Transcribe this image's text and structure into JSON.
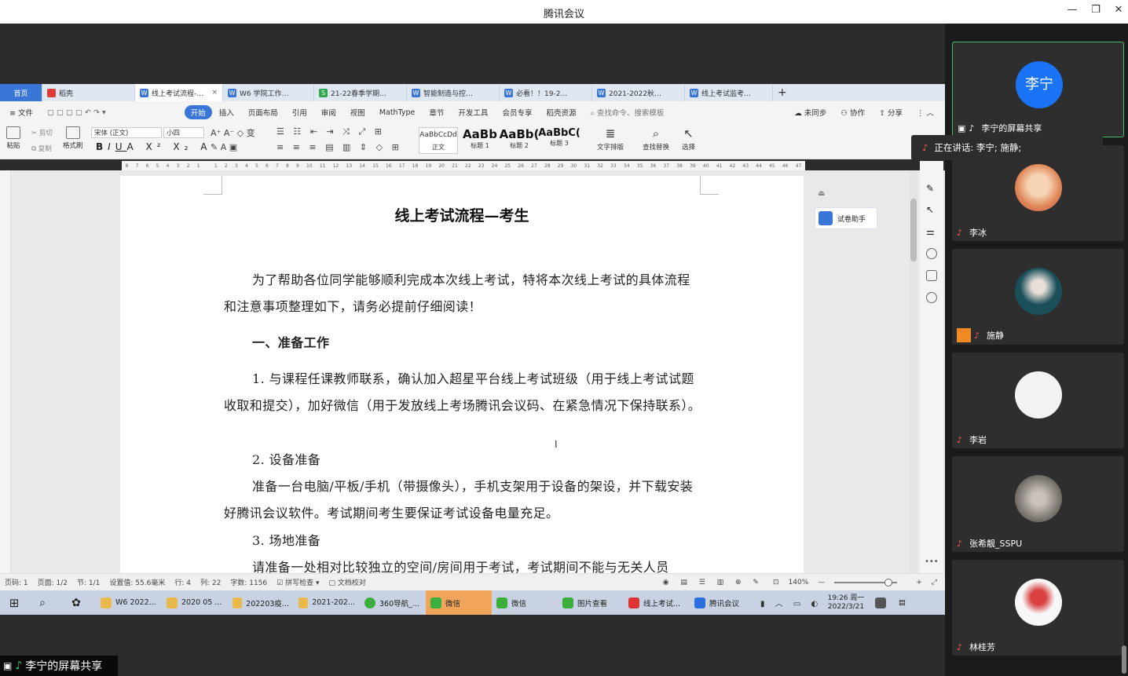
{
  "window": {
    "title": "腾讯会议"
  },
  "wps": {
    "tabs": [
      {
        "label": "首页",
        "kind": "home"
      },
      {
        "label": "稻壳",
        "color": "#e03b3b"
      },
      {
        "label": "线上考试流程-…",
        "color": "#3a76d8",
        "active": true
      },
      {
        "label": "W6 学院工作…",
        "color": "#3a76d8"
      },
      {
        "label": "21-22春季学期…",
        "color": "#2fa94e"
      },
      {
        "label": "智能制造与控…",
        "color": "#3a76d8"
      },
      {
        "label": "必看！！19-2…",
        "color": "#3a76d8"
      },
      {
        "label": "2021-2022秋…",
        "color": "#3a76d8"
      },
      {
        "label": "线上考试监考…",
        "color": "#3a76d8"
      }
    ],
    "menu": [
      "文件",
      "开始",
      "插入",
      "页面布局",
      "引用",
      "审阅",
      "视图",
      "MathType",
      "章节",
      "开发工具",
      "会员专享",
      "稻壳资源",
      "查找命令、搜索模板"
    ],
    "menu_right": [
      "未同步",
      "协作",
      "分享"
    ],
    "ribbon": {
      "paste": "粘贴",
      "cut": "剪切",
      "copy": "复制",
      "format_painter": "格式刷",
      "font_name": "宋体 (正文)",
      "font_size": "小四",
      "styles": [
        {
          "preview": "AaBbCcDd",
          "label": "正文"
        },
        {
          "preview": "AaBb",
          "label": "标题 1"
        },
        {
          "preview": "AaBb(",
          "label": "标题 2"
        },
        {
          "preview": "AaBbC(",
          "label": "标题 3"
        }
      ],
      "text_layout": "文字排版",
      "find_replace": "查找替换",
      "select": "选择"
    },
    "ruler_ticks": [
      "8",
      "7",
      "6",
      "5",
      "4",
      "3",
      "2",
      "1",
      "",
      "1",
      "2",
      "3",
      "4",
      "5",
      "6",
      "7",
      "8",
      "9",
      "10",
      "11",
      "12",
      "13",
      "14",
      "15",
      "16",
      "17",
      "18",
      "19",
      "20",
      "21",
      "22",
      "23",
      "24",
      "25",
      "26",
      "27",
      "28",
      "29",
      "30",
      "31",
      "32",
      "33",
      "34",
      "35",
      "36",
      "37",
      "38",
      "39",
      "40",
      "41",
      "42",
      "43",
      "44",
      "45",
      "46",
      "47"
    ],
    "document": {
      "title": "线上考试流程—考生",
      "intro": "为了帮助各位同学能够顺利完成本次线上考试，特将本次线上考试的具体流程和注意事项整理如下，请务必提前仔细阅读！",
      "section1": "一、准备工作",
      "item1": "1.  与课程任课教师联系，确认加入超星平台线上考试班级（用于线上考试试题收取和提交），加好微信（用于发放线上考场腾讯会议码、在紧急情况下保持联系）。",
      "item2_head": "2.  设备准备",
      "item2_body": "准备一台电脑/平板/手机（带摄像头），手机支架用于设备的架设，并下载安装好腾讯会议软件。考试期间考生要保证考试设备电量充足。",
      "item3_head": "3.  场地准备",
      "item3_body": "请准备一处相对比较独立的空间/房间用于考试，考试期间不能与无关人员"
    },
    "assistant": "试卷助手",
    "status": {
      "page_num": "页码: 1",
      "pages": "页面: 1/2",
      "section": "节: 1/1",
      "setting": "设置值: 55.6毫米",
      "row": "行: 4",
      "col": "列: 22",
      "words": "字数: 1156",
      "spell": "拼写检查",
      "proof": "文档校对",
      "zoom": "140%"
    }
  },
  "taskbar": {
    "items": [
      {
        "label": "W6 2022...",
        "color": "#e8b84a"
      },
      {
        "label": "2020 05 ...",
        "color": "#e8b84a"
      },
      {
        "label": "202203疫...",
        "color": "#e8b84a"
      },
      {
        "label": "2021-202...",
        "color": "#e8b84a"
      },
      {
        "label": "360导航_...",
        "color": "#3cae3c"
      },
      {
        "label": "微信",
        "color": "#3cae3c",
        "highlight": true
      },
      {
        "label": "微信",
        "color": "#3cae3c"
      },
      {
        "label": "图片查看",
        "color": "#3cae3c"
      },
      {
        "label": "线上考试...",
        "color": "#d33"
      },
      {
        "label": "腾讯会议",
        "color": "#2a6fdb"
      }
    ],
    "time": "19:26 周一",
    "date": "2022/3/21"
  },
  "share_label": "李宁的屏幕共享",
  "speaking": "正在讲话: 李宁; 施静;",
  "participants": [
    {
      "name": "李宁的屏幕共享",
      "avatar_text": "李宁",
      "avatar_color": "#1a73f5",
      "active": true
    },
    {
      "name": "李冰",
      "avatar_color": "#e59a6a"
    },
    {
      "name": "施静",
      "avatar_color": "#1b4f5a",
      "host": true
    },
    {
      "name": "李岩",
      "avatar_color": "#f2f2f2"
    },
    {
      "name": "张希靓_SSPU",
      "avatar_color": "#8f8a84"
    },
    {
      "name": "林桂芳",
      "avatar_color": "#f7f7f7"
    }
  ]
}
